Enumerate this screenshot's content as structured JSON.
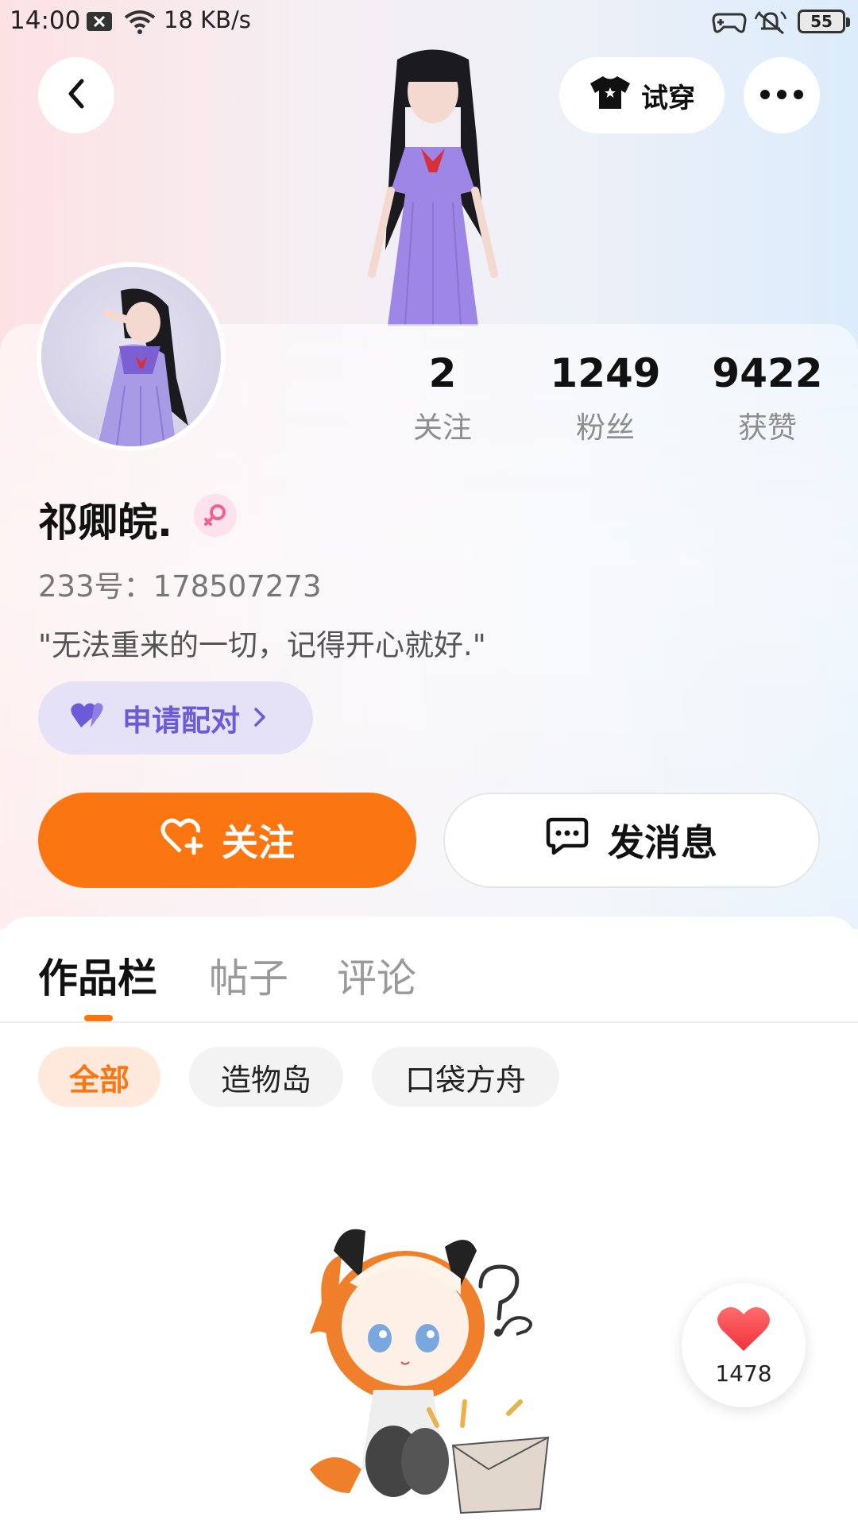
{
  "status_bar": {
    "time": "14:00",
    "speed": "18 KB/s",
    "battery": "55"
  },
  "header": {
    "tryon_label": "试穿"
  },
  "stats": [
    {
      "value": "2",
      "label": "关注"
    },
    {
      "value": "1249",
      "label": "粉丝"
    },
    {
      "value": "9422",
      "label": "获赞"
    }
  ],
  "profile": {
    "name": "祁卿皖.",
    "uid": "233号：178507273",
    "bio": "\"无法重来的一切，记得开心就好.\"",
    "pair_label": "申请配对"
  },
  "actions": {
    "follow_label": "关注",
    "message_label": "发消息"
  },
  "tabs": [
    {
      "label": "作品栏"
    },
    {
      "label": "帖子"
    },
    {
      "label": "评论"
    }
  ],
  "chips": [
    {
      "label": "全部"
    },
    {
      "label": "造物岛"
    },
    {
      "label": "口袋方舟"
    }
  ],
  "like_float": {
    "count": "1478"
  },
  "colors": {
    "accent": "#FB7510",
    "pair": "#6B5BD6",
    "pair_bg": "#E5E1F6",
    "gender": "#F06292"
  }
}
